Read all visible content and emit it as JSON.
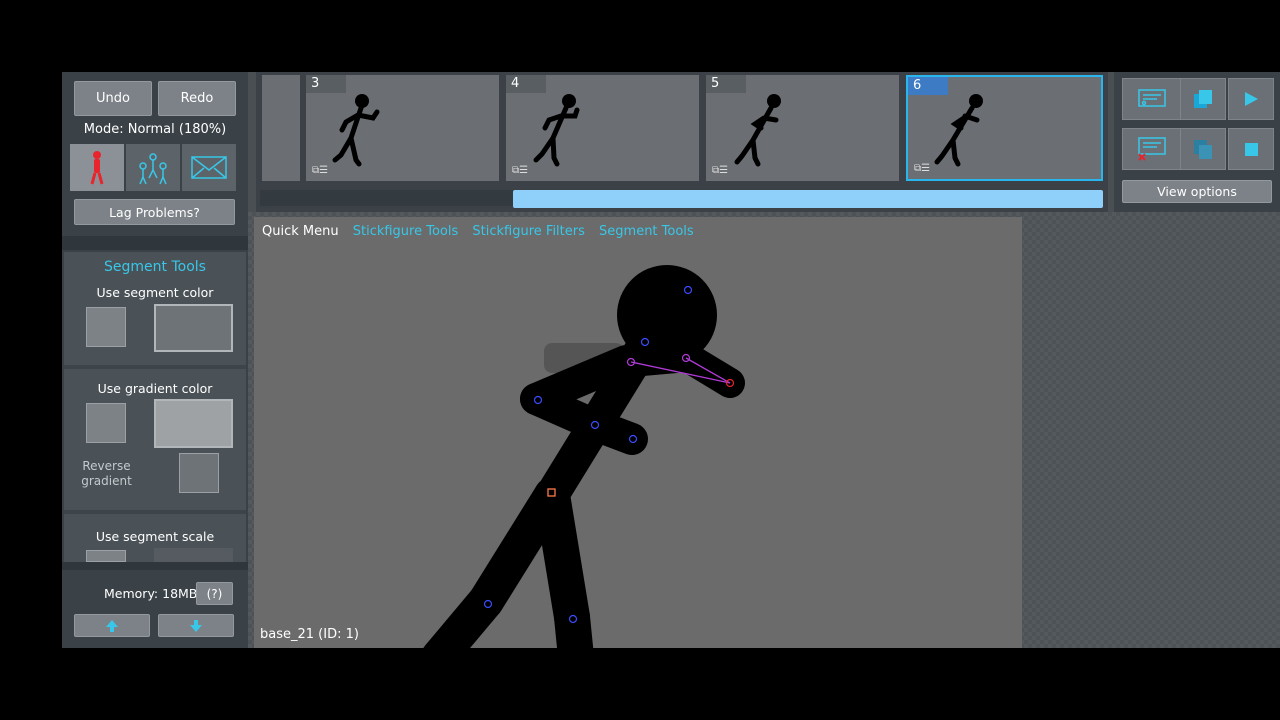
{
  "toolbar": {
    "undo_label": "Undo",
    "redo_label": "Redo",
    "mode_label": "Mode: Normal (180%)",
    "lag_label": "Lag Problems?"
  },
  "segment_tools": {
    "title": "Segment Tools",
    "use_segment_color": "Use segment color",
    "use_gradient_color": "Use gradient color",
    "reverse_gradient": "Reverse gradient",
    "use_segment_scale": "Use segment scale"
  },
  "memory": {
    "label": "Memory: 18MB",
    "help_label": "(?)"
  },
  "frames": [
    {
      "number": "3"
    },
    {
      "number": "4"
    },
    {
      "number": "5"
    },
    {
      "number": "6"
    }
  ],
  "view_options_label": "View options",
  "quick_menu": {
    "label": "Quick Menu",
    "links": [
      "Stickfigure Tools",
      "Stickfigure Filters",
      "Segment Tools"
    ]
  },
  "status": {
    "selection": "base_21 (ID: 1)"
  },
  "colors": {
    "accent": "#38c7e8",
    "active_frame": "#29b6ec",
    "scroll_thumb": "#8fd0fb",
    "stick_mode": "#e8242c"
  },
  "icons": [
    "stickfigure-icon",
    "group-icon",
    "image-icon",
    "arrow-up-icon",
    "arrow-down-icon",
    "add-frame-icon",
    "copy-frame-icon",
    "play-icon",
    "delete-frame-icon",
    "paste-frame-icon",
    "stop-icon"
  ]
}
